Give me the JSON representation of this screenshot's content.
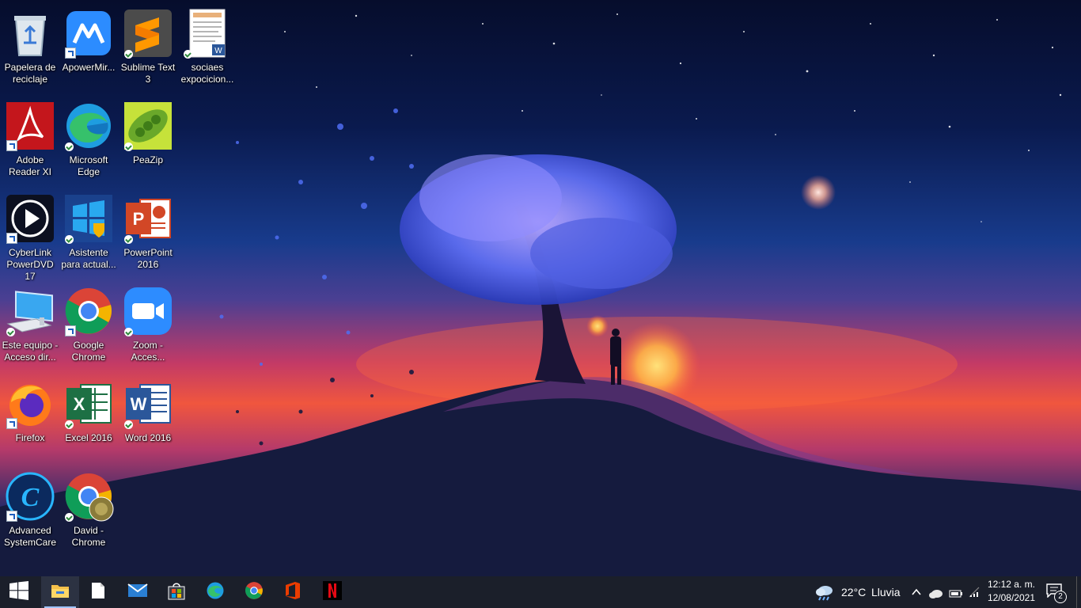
{
  "desktop": {
    "icons": [
      {
        "label": "Papelera de\nreciclaje",
        "icon": "recycle-bin-icon"
      },
      {
        "label": "ApowerMir...",
        "icon": "apowermirror-icon"
      },
      {
        "label": "Sublime Text\n3",
        "icon": "sublime-text-icon"
      },
      {
        "label": "sociaes\nexpocicion...",
        "icon": "word-document-icon"
      },
      {
        "label": "Adobe\nReader XI",
        "icon": "adobe-reader-icon"
      },
      {
        "label": "Microsoft\nEdge",
        "icon": "edge-icon"
      },
      {
        "label": "PeaZip",
        "icon": "peazip-icon"
      },
      {
        "label": "CyberLink\nPowerDVD 17",
        "icon": "powerdvd-icon"
      },
      {
        "label": "Asistente\npara actual...",
        "icon": "windows-update-assistant-icon"
      },
      {
        "label": "PowerPoint\n2016",
        "icon": "powerpoint-icon"
      },
      {
        "label": "Este equipo -\nAcceso dir...",
        "icon": "this-pc-icon"
      },
      {
        "label": "Google\nChrome",
        "icon": "chrome-icon"
      },
      {
        "label": "Zoom -\nAcces...",
        "icon": "zoom-icon"
      },
      {
        "label": "Firefox",
        "icon": "firefox-icon"
      },
      {
        "label": "Excel 2016",
        "icon": "excel-icon"
      },
      {
        "label": "Word 2016",
        "icon": "word-icon"
      },
      {
        "label": "Advanced\nSystemCare",
        "icon": "advanced-systemcare-icon"
      },
      {
        "label": "David -\nChrome",
        "icon": "chrome-profile-icon"
      }
    ]
  },
  "taskbar": {
    "pinned": [
      "start-icon",
      "file-explorer-icon",
      "notepad-icon",
      "mail-icon",
      "store-icon",
      "edge-icon",
      "chrome-icon",
      "office-icon",
      "netflix-icon"
    ],
    "weather": {
      "temperature": "22°C",
      "condition": "Lluvia"
    },
    "clock": {
      "time": "12:12 a. m.",
      "date": "12/08/2021"
    },
    "notifications": {
      "count": "2"
    }
  },
  "colors": {
    "taskbar": "#1b1f2a",
    "accent": "#1e5fbf"
  }
}
